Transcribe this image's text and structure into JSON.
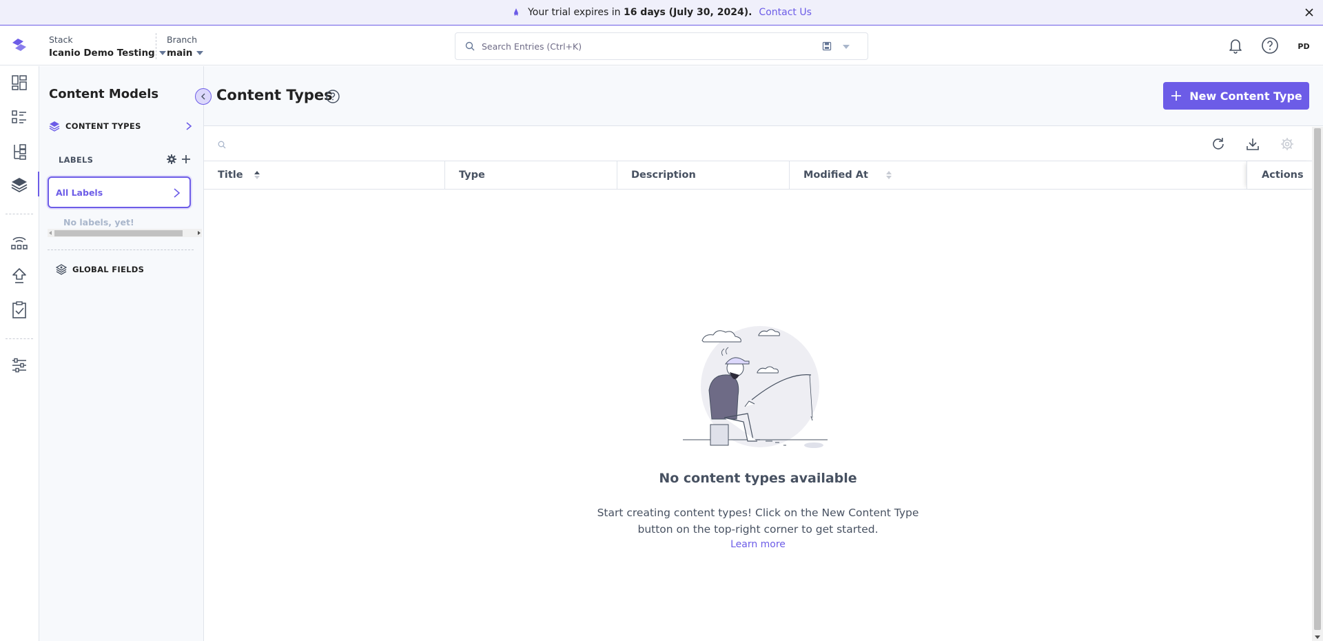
{
  "banner": {
    "prefix": "Your trial expires in ",
    "highlight": "16 days (July 30, 2024).",
    "contact": "Contact Us"
  },
  "header": {
    "stack_label": "Stack",
    "stack_value": "Icanio Demo Testing",
    "branch_label": "Branch",
    "branch_value": "main",
    "search_placeholder": "Search Entries (Ctrl+K)",
    "avatar_initials": "PD"
  },
  "left_panel": {
    "title": "Content Models",
    "content_types": "CONTENT TYPES",
    "labels_heading": "LABELS",
    "all_labels": "All Labels",
    "no_labels": "No labels, yet!",
    "global_fields": "GLOBAL FIELDS"
  },
  "main": {
    "title": "Content Types",
    "new_button": "New Content Type",
    "columns": {
      "title": "Title",
      "type": "Type",
      "description": "Description",
      "modified_at": "Modified At",
      "actions": "Actions"
    },
    "empty_title": "No content types available",
    "empty_desc": "Start creating content types! Click on the New Content Type button on the top-right corner to get started.",
    "learn_more": "Learn more"
  },
  "colors": {
    "accent": "#6c5ce7",
    "banner_bg": "#f0f0fb",
    "panel_bg": "#f7f9fc",
    "text_muted": "#475161"
  }
}
